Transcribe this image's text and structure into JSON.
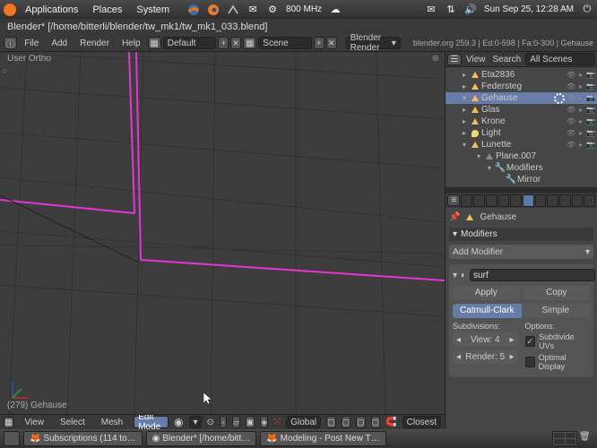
{
  "system": {
    "menus": [
      "Applications",
      "Places",
      "System"
    ],
    "cpu_freq": "800 MHz",
    "date_time": "Sun Sep 25, 12:28 AM"
  },
  "window": {
    "title": "Blender* [/home/bitterli/blender/tw_mk1/tw_mk1_033.blend]"
  },
  "top_header": {
    "file_menu": "File",
    "add_menu": "Add",
    "render_menu": "Render",
    "help_menu": "Help",
    "layout": "Default",
    "scene": "Scene",
    "engine": "Blender Render",
    "status": "blender.org 259.3 | Ed:0-598 | Fa:0-300 | Gehause"
  },
  "viewport": {
    "header_text": "User Ortho",
    "object_info": "(279) Gehause",
    "footer": {
      "view": "View",
      "select": "Select",
      "mesh": "Mesh",
      "mode": "Edit Mode",
      "orientation": "Global",
      "snap_mode": "Closest"
    }
  },
  "outliner": {
    "header": {
      "view": "View",
      "search": "Search",
      "filter": "All Scenes"
    },
    "items": [
      {
        "label": "Eta2836",
        "type": "mesh",
        "indent": 14,
        "expand": "▸"
      },
      {
        "label": "Federsteg",
        "type": "mesh",
        "indent": 14,
        "expand": "▸"
      },
      {
        "label": "Gehause",
        "type": "mesh",
        "indent": 14,
        "expand": "▾",
        "active": true
      },
      {
        "label": "Glas",
        "type": "mesh",
        "indent": 14,
        "expand": "▸"
      },
      {
        "label": "Krone",
        "type": "mesh",
        "indent": 14,
        "expand": "▸"
      },
      {
        "label": "Light",
        "type": "lamp",
        "indent": 14,
        "expand": "▸"
      },
      {
        "label": "Lunette",
        "type": "mesh",
        "indent": 14,
        "expand": "▾"
      },
      {
        "label": "Plane.007",
        "type": "data",
        "indent": 30,
        "expand": "▾"
      },
      {
        "label": "Modifiers",
        "type": "mod",
        "indent": 42,
        "expand": "▾"
      },
      {
        "label": "Mirror",
        "type": "mod",
        "indent": 54,
        "expand": ""
      }
    ]
  },
  "properties": {
    "object_name": "Gehause",
    "panel_title": "Modifiers",
    "add_modifier": "Add Modifier",
    "mod": {
      "name": "surf",
      "apply": "Apply",
      "copy": "Copy",
      "type_a": "Catmull-Clark",
      "type_b": "Simple",
      "subdiv_label": "Subdivisions:",
      "options_label": "Options:",
      "view": "View: 4",
      "render": "Render: 5",
      "subdivide_uvs": "Subdivide UVs",
      "optimal_display": "Optimal Display"
    }
  },
  "taskbar": {
    "task1": "Subscriptions (114 to…",
    "task2": "Blender* [/home/bitt…",
    "task3": "Modeling - Post New T…"
  }
}
